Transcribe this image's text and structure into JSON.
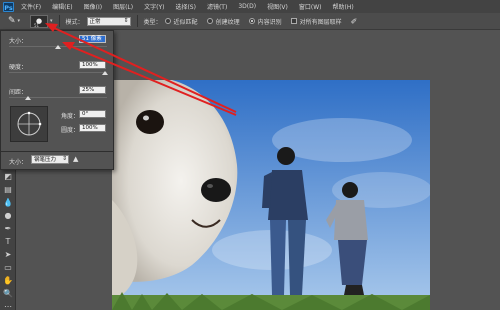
{
  "app": {
    "logo": "Ps"
  },
  "menu": [
    "文件(F)",
    "编辑(E)",
    "图像(I)",
    "图层(L)",
    "文字(Y)",
    "选择(S)",
    "滤镜(T)",
    "3D(D)",
    "视图(V)",
    "窗口(W)",
    "帮助(H)"
  ],
  "options": {
    "brush_size_num": "51",
    "mode_label": "模式：",
    "mode_value": "正常",
    "type_label": "类型：",
    "type_options": [
      {
        "label": "近似匹配",
        "selected": false
      },
      {
        "label": "创建纹理",
        "selected": false
      },
      {
        "label": "内容识别",
        "selected": true
      }
    ],
    "sample_all_label": "对所有图层取样"
  },
  "brush_panel": {
    "size_label": "大小：",
    "size_value": "51 像素",
    "hardness_label": "硬度：",
    "hardness_value": "100%",
    "spacing_label": "间距：",
    "spacing_value": "25%",
    "angle_label": "角度：",
    "angle_value": "0°",
    "roundness_label": "圆度：",
    "roundness_value": "100%",
    "bottom_size_label": "大小：",
    "pressure_value": "钢笔压力"
  },
  "colors": {
    "arrow": "#e02020",
    "sky_top": "#2f6fc6",
    "sky_bottom": "#a9c9ec"
  }
}
